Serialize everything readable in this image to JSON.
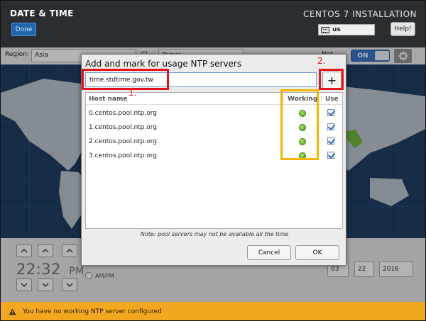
{
  "header": {
    "screen_title": "DATE & TIME",
    "done_label": "Done",
    "install_title": "CENTOS 7 INSTALLATION",
    "keyboard_layout": "us",
    "help_label": "Help!"
  },
  "toolbar": {
    "region_label": "Region:",
    "region_value": "Asia",
    "city_label": "Ci",
    "city_value": "Taipei",
    "ntp_label": "Net",
    "ntp_state": "ON"
  },
  "time": {
    "display": "22:32",
    "suffix": "PM",
    "ampm_label": "AM/PM",
    "month": "03",
    "day": "22",
    "year": "2016"
  },
  "warning": {
    "text": "You have no working NTP server configured"
  },
  "dialog": {
    "title": "Add and mark for usage NTP servers",
    "input_value": "time.stdtime.gov.tw",
    "add_label": "+",
    "columns": {
      "host": "Host name",
      "working": "Working",
      "use": "Use"
    },
    "servers": [
      {
        "host": "0.centos.pool.ntp.org"
      },
      {
        "host": "1.centos.pool.ntp.org"
      },
      {
        "host": "2.centos.pool.ntp.org"
      },
      {
        "host": "3.centos.pool.ntp.org"
      }
    ],
    "note": "Note: pool servers may not be available all the time",
    "cancel_label": "Cancel",
    "ok_label": "OK"
  },
  "annotations": {
    "step1": "1.",
    "step2": "2.",
    "red": "#e8141b",
    "yellow": "#f6b400"
  },
  "colors": {
    "accent": "#3a74c4",
    "warning": "#f2a720",
    "working_ok": "#5aae1e"
  }
}
